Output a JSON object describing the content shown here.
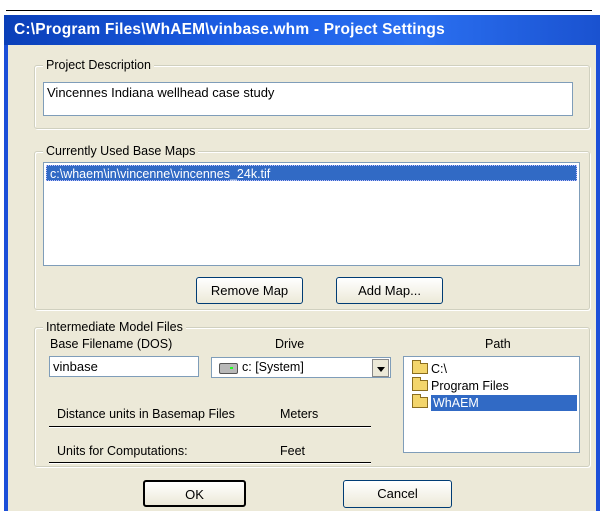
{
  "window": {
    "title": "C:\\Program Files\\WhAEM\\vinbase.whm - Project Settings"
  },
  "project_description": {
    "group_label": "Project Description",
    "value": "Vincennes Indiana wellhead case study"
  },
  "base_maps": {
    "group_label": "Currently Used Base Maps",
    "items": [
      "c:\\whaem\\in\\vincenne\\vincennes_24k.tif"
    ],
    "remove_label": "Remove Map",
    "add_label": "Add Map..."
  },
  "model_files": {
    "group_label": "Intermediate Model Files",
    "base_filename_label": "Base Filename  (DOS)",
    "base_filename_value": "vinbase",
    "drive_label": "Drive",
    "drive_value": "c: [System]",
    "path_label": "Path",
    "path_items": [
      "C:\\",
      "Program Files",
      "WhAEM"
    ],
    "distance_units_label": "Distance units in Basemap Files",
    "distance_units_value": "Meters",
    "computation_units_label": "Units for Computations:",
    "computation_units_value": "Feet"
  },
  "buttons": {
    "ok": "OK",
    "cancel": "Cancel"
  }
}
